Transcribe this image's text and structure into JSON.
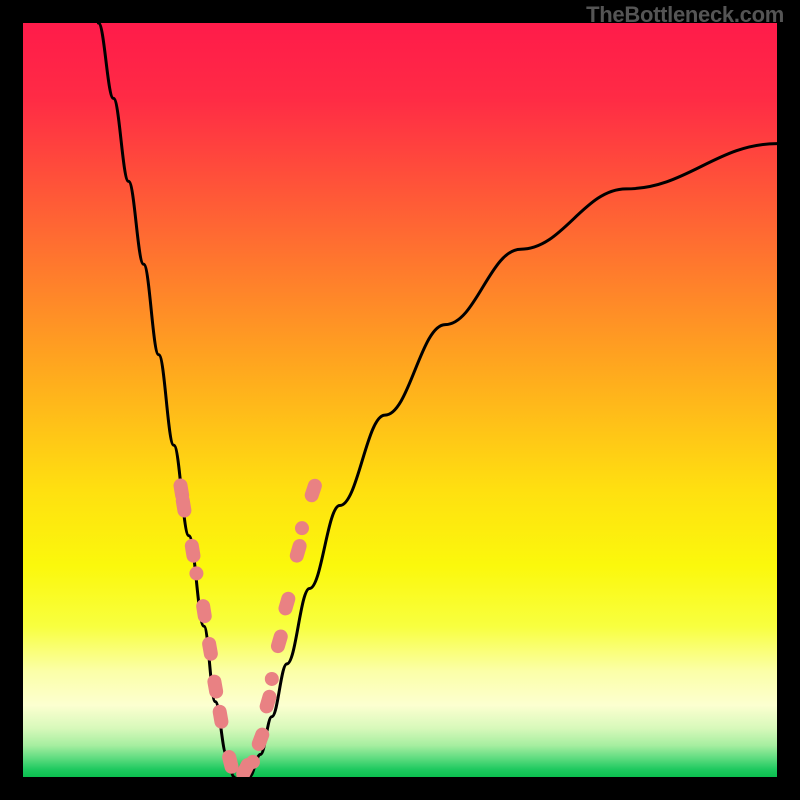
{
  "watermark": "TheBottleneck.com",
  "chart_data": {
    "type": "line",
    "title": "",
    "xlabel": "",
    "ylabel": "",
    "xlim": [
      0,
      100
    ],
    "ylim": [
      0,
      100
    ],
    "grid": false,
    "series": [
      {
        "name": "left-curve",
        "x": [
          10,
          12,
          14,
          16,
          18,
          20,
          22,
          24,
          25.5,
          27,
          28
        ],
        "y": [
          100,
          90,
          79,
          68,
          56,
          44,
          32,
          20,
          10,
          3,
          0
        ]
      },
      {
        "name": "right-curve",
        "x": [
          30,
          31.5,
          33,
          35,
          38,
          42,
          48,
          56,
          66,
          80,
          100
        ],
        "y": [
          0,
          3,
          8,
          15,
          25,
          36,
          48,
          60,
          70,
          78,
          84
        ]
      }
    ],
    "markers": [
      {
        "series": "left-curve",
        "x": 21.0,
        "y": 38,
        "shape": "pill"
      },
      {
        "series": "left-curve",
        "x": 21.3,
        "y": 36,
        "shape": "pill"
      },
      {
        "series": "left-curve",
        "x": 22.5,
        "y": 30,
        "shape": "pill"
      },
      {
        "series": "left-curve",
        "x": 23.0,
        "y": 27,
        "shape": "dot"
      },
      {
        "series": "left-curve",
        "x": 24.0,
        "y": 22,
        "shape": "pill"
      },
      {
        "series": "left-curve",
        "x": 24.8,
        "y": 17,
        "shape": "pill"
      },
      {
        "series": "left-curve",
        "x": 25.5,
        "y": 12,
        "shape": "pill"
      },
      {
        "series": "left-curve",
        "x": 26.2,
        "y": 8,
        "shape": "pill"
      },
      {
        "series": "left-curve",
        "x": 27.5,
        "y": 2,
        "shape": "pill"
      },
      {
        "series": "right-curve",
        "x": 29.5,
        "y": 1,
        "shape": "pill"
      },
      {
        "series": "right-curve",
        "x": 30.5,
        "y": 2,
        "shape": "dot"
      },
      {
        "series": "right-curve",
        "x": 31.5,
        "y": 5,
        "shape": "pill"
      },
      {
        "series": "right-curve",
        "x": 32.5,
        "y": 10,
        "shape": "pill"
      },
      {
        "series": "right-curve",
        "x": 33.0,
        "y": 13,
        "shape": "dot"
      },
      {
        "series": "right-curve",
        "x": 34.0,
        "y": 18,
        "shape": "pill"
      },
      {
        "series": "right-curve",
        "x": 35.0,
        "y": 23,
        "shape": "pill"
      },
      {
        "series": "right-curve",
        "x": 36.5,
        "y": 30,
        "shape": "pill"
      },
      {
        "series": "right-curve",
        "x": 37.0,
        "y": 33,
        "shape": "dot"
      },
      {
        "series": "right-curve",
        "x": 38.5,
        "y": 38,
        "shape": "pill"
      }
    ],
    "marker_color": "#e98183",
    "curve_stroke": "#000000",
    "gradient_stops": [
      {
        "pos": 0.0,
        "color": "#ff1b4a"
      },
      {
        "pos": 0.1,
        "color": "#ff2b45"
      },
      {
        "pos": 0.28,
        "color": "#ff6a32"
      },
      {
        "pos": 0.45,
        "color": "#ffa51f"
      },
      {
        "pos": 0.62,
        "color": "#ffe010"
      },
      {
        "pos": 0.72,
        "color": "#fbf80c"
      },
      {
        "pos": 0.8,
        "color": "#f8ff3f"
      },
      {
        "pos": 0.86,
        "color": "#fbffa8"
      },
      {
        "pos": 0.905,
        "color": "#fcffd0"
      },
      {
        "pos": 0.935,
        "color": "#d8f9bb"
      },
      {
        "pos": 0.958,
        "color": "#a6eea0"
      },
      {
        "pos": 0.975,
        "color": "#5fdc80"
      },
      {
        "pos": 0.99,
        "color": "#1ec95f"
      },
      {
        "pos": 1.0,
        "color": "#0bbf4f"
      }
    ]
  }
}
